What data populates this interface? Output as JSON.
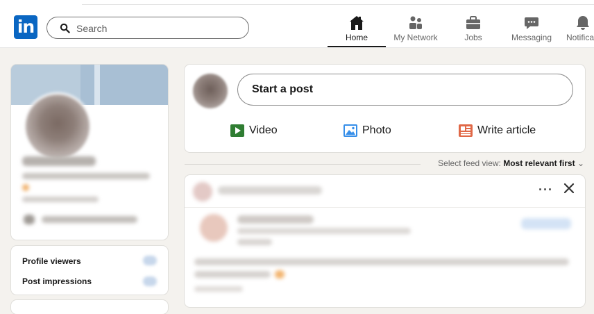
{
  "header": {
    "logo": "in",
    "search": {
      "placeholder": "Search",
      "value": ""
    },
    "nav": [
      {
        "label": "Home",
        "icon": "home-icon",
        "active": true
      },
      {
        "label": "My Network",
        "icon": "my-network-icon",
        "active": false
      },
      {
        "label": "Jobs",
        "icon": "briefcase-icon",
        "active": false
      },
      {
        "label": "Messaging",
        "icon": "messaging-icon",
        "active": false
      },
      {
        "label": "Notifica",
        "icon": "bell-icon",
        "active": false
      }
    ]
  },
  "sidebar": {
    "stats": [
      {
        "label": "Profile viewers"
      },
      {
        "label": "Post impressions"
      }
    ]
  },
  "share_box": {
    "start_post": "Start a post",
    "actions": [
      {
        "label": "Video",
        "icon": "video-icon",
        "color": "#378fe9"
      },
      {
        "label": "Photo",
        "icon": "photo-icon",
        "color": "#378fe9"
      },
      {
        "label": "Write article",
        "icon": "article-icon",
        "color": "#e06847"
      }
    ]
  },
  "feed": {
    "sort_prefix": "Select feed view:",
    "sort_value": "Most relevant first",
    "sort_caret": "⌄"
  },
  "post": {
    "menu_label": "···"
  },
  "colors": {
    "brand": "#0a66c2",
    "background": "#f4f2ee",
    "video": "#2f7d32",
    "photo": "#378fe9",
    "article": "#e06847"
  }
}
